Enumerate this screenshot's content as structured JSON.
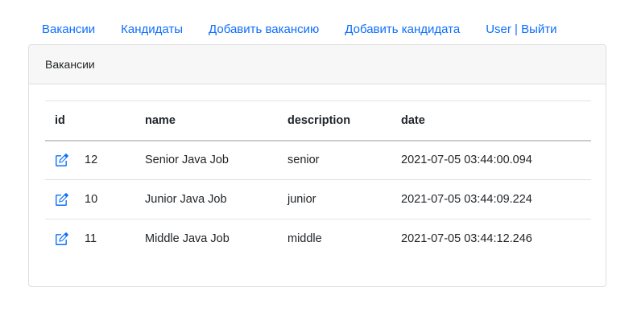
{
  "nav": {
    "items": [
      {
        "label": "Вакансии"
      },
      {
        "label": "Кандидаты"
      },
      {
        "label": "Добавить вакансию"
      },
      {
        "label": "Добавить кандидата"
      },
      {
        "label": "User | Выйти"
      }
    ]
  },
  "card": {
    "title": "Вакансии"
  },
  "table": {
    "headers": {
      "id": "id",
      "name": "name",
      "description": "description",
      "date": "date"
    },
    "rows": [
      {
        "id": "12",
        "name": "Senior Java Job",
        "description": "senior",
        "date": "2021-07-05 03:44:00.094"
      },
      {
        "id": "10",
        "name": "Junior Java Job",
        "description": "junior",
        "date": "2021-07-05 03:44:09.224"
      },
      {
        "id": "11",
        "name": "Middle Java Job",
        "description": "middle",
        "date": "2021-07-05 03:44:12.246"
      }
    ]
  },
  "icons": {
    "edit": "edit-icon"
  },
  "colors": {
    "link": "#0d6efd",
    "header_bg": "#f7f7f7"
  }
}
